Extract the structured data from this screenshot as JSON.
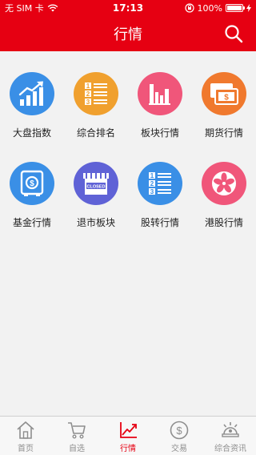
{
  "status_bar": {
    "carrier": "无 SIM 卡",
    "time": "17:13",
    "battery_percent": "100%",
    "battery_level": 1.0
  },
  "navbar": {
    "title": "行情",
    "search_icon": "search-icon"
  },
  "grid_items": [
    {
      "label": "大盘指数",
      "icon": "trend-chart-icon",
      "color": "#3a8fe6"
    },
    {
      "label": "综合排名",
      "icon": "ranking-list-icon",
      "color": "#f0a02e"
    },
    {
      "label": "板块行情",
      "icon": "bar-chart-icon",
      "color": "#f0567a"
    },
    {
      "label": "期货行情",
      "icon": "banknote-icon",
      "color": "#f0792e"
    },
    {
      "label": "基金行情",
      "icon": "fund-safe-icon",
      "color": "#3a8fe6"
    },
    {
      "label": "退市板块",
      "icon": "closed-store-icon",
      "color": "#5f62d6"
    },
    {
      "label": "股转行情",
      "icon": "ranking-list-icon",
      "color": "#3a8fe6"
    },
    {
      "label": "港股行情",
      "icon": "hk-flower-icon",
      "color": "#f0567a"
    }
  ],
  "tabbar": {
    "items": [
      {
        "label": "首页",
        "icon": "home-icon"
      },
      {
        "label": "自选",
        "icon": "cart-icon"
      },
      {
        "label": "行情",
        "icon": "trend-icon"
      },
      {
        "label": "交易",
        "icon": "dollar-icon"
      },
      {
        "label": "综合资讯",
        "icon": "news-icon"
      }
    ],
    "active_label": "行情",
    "active_color": "#e60012",
    "inactive_color": "#8e8e8e"
  }
}
